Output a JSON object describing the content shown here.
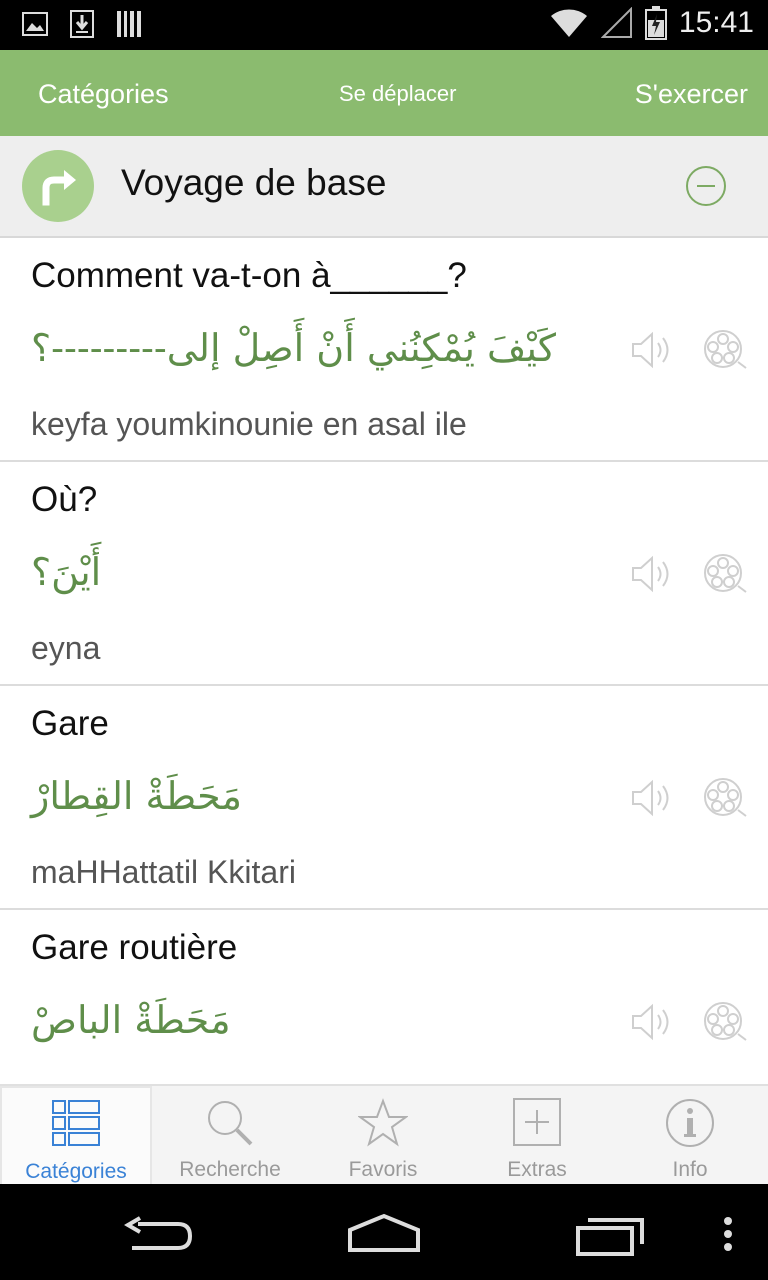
{
  "status_bar": {
    "time": "15:41"
  },
  "top_nav": {
    "categories": "Catégories",
    "move": "Se déplacer",
    "practice": "S'exercer"
  },
  "category": {
    "title": "Voyage de base"
  },
  "phrases": [
    {
      "french": "Comment va-t-on à______?",
      "arabic": "كَيْفَ يُمْكِنُني أَنْ أَصِلْ إلى---------؟",
      "transliteration": "keyfa youmkinounie en asal ile"
    },
    {
      "french": "Où?",
      "arabic": "أَيْنَ؟",
      "transliteration": "eyna"
    },
    {
      "french": "Gare",
      "arabic": "مَحَطَةْ القِطارْ",
      "transliteration": "maHHattatil Kkitari"
    },
    {
      "french": "Gare routière",
      "arabic": "مَحَطَةْ الباصْ",
      "transliteration": ""
    }
  ],
  "bottom_tabs": [
    {
      "label": "Catégories",
      "icon": "list-icon"
    },
    {
      "label": "Recherche",
      "icon": "search-icon"
    },
    {
      "label": "Favoris",
      "icon": "star-icon"
    },
    {
      "label": "Extras",
      "icon": "plus-box-icon"
    },
    {
      "label": "Info",
      "icon": "info-icon"
    }
  ],
  "colors": {
    "header_green": "#8bbb6f",
    "arabic_green": "#5f8e4a",
    "active_tab_blue": "#3a82d6"
  }
}
